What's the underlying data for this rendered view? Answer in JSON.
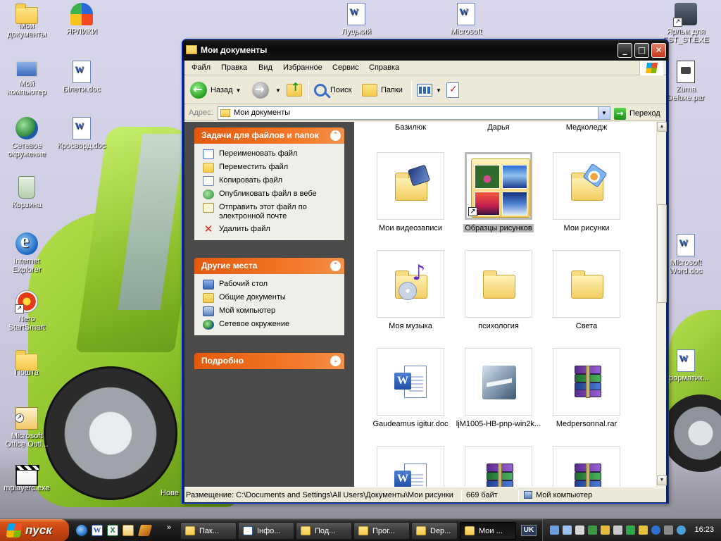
{
  "desktop": {
    "icons_left": [
      {
        "label": "Мои документы",
        "icon": "my-documents-icon"
      },
      {
        "label": "Мой компьютер",
        "icon": "my-computer-icon"
      },
      {
        "label": "Сетевое окружение",
        "icon": "network-places-icon"
      },
      {
        "label": "Корзина",
        "icon": "recycle-bin-icon"
      },
      {
        "label": "Internet Explorer",
        "icon": "internet-explorer-icon"
      },
      {
        "label": "Nero StartSmart",
        "icon": "nero-icon"
      },
      {
        "label": "Пошта",
        "icon": "folder-icon"
      },
      {
        "label": "Microsoft Office Outl...",
        "icon": "outlook-icon"
      },
      {
        "label": "mplayerc.exe",
        "icon": "media-player-icon"
      }
    ],
    "icons_col2": [
      {
        "label": "ЯРЛИКИ",
        "icon": "butterfly-icon"
      },
      {
        "label": "Білети.doc",
        "icon": "word-doc-icon"
      },
      {
        "label": "Кросворд.doc",
        "icon": "word-doc-icon"
      }
    ],
    "icons_top": [
      {
        "label": "Луцький",
        "icon": "word-doc-icon"
      },
      {
        "label": "Microsoft",
        "icon": "word-doc-icon"
      }
    ],
    "icons_right": [
      {
        "label": "Ярлык для EST_ST.EXE",
        "icon": "shortcut-app-icon"
      },
      {
        "label": "Zuma Deluxe.par",
        "icon": "zuma-file-icon"
      },
      {
        "label": "Microsoft Word.doc",
        "icon": "word-doc-icon"
      },
      {
        "label": "нформатик...",
        "icon": "word-doc-icon"
      }
    ],
    "hidden_partial_label": "Нове"
  },
  "window": {
    "title": "Мои документы",
    "menu": [
      "Файл",
      "Правка",
      "Вид",
      "Избранное",
      "Сервис",
      "Справка"
    ],
    "toolbar": {
      "back": "Назад",
      "search": "Поиск",
      "folders": "Папки"
    },
    "address": {
      "label": "Адрес:",
      "value": "Мои документы",
      "go": "Переход"
    },
    "tasks_panel": {
      "title": "Задачи для файлов и папок",
      "items": [
        {
          "label": "Переименовать файл",
          "icon": "rename-icon"
        },
        {
          "label": "Переместить файл",
          "icon": "move-icon"
        },
        {
          "label": "Копировать файл",
          "icon": "copy-icon"
        },
        {
          "label": "Опубликовать файл в вебе",
          "icon": "publish-web-icon"
        },
        {
          "label": "Отправить этот файл по электронной почте",
          "icon": "email-icon"
        },
        {
          "label": "Удалить файл",
          "icon": "delete-icon"
        }
      ]
    },
    "places_panel": {
      "title": "Другие места",
      "items": [
        {
          "label": "Рабочий стол",
          "icon": "desktop-icon"
        },
        {
          "label": "Общие документы",
          "icon": "shared-docs-icon"
        },
        {
          "label": "Мой компьютер",
          "icon": "my-computer-icon"
        },
        {
          "label": "Сетевое окружение",
          "icon": "network-icon"
        }
      ]
    },
    "details_panel": {
      "title": "Подробно"
    },
    "files_partial_top": [
      "Базилюк",
      "Дарья",
      "Медколедж"
    ],
    "files": [
      {
        "label": "Мои видеозаписи",
        "kind": "video-folder"
      },
      {
        "label": "Образцы рисунков",
        "kind": "sample-pictures",
        "selected": true
      },
      {
        "label": "Мои рисунки",
        "kind": "pictures-folder"
      },
      {
        "label": "Моя музыка",
        "kind": "music-folder"
      },
      {
        "label": "психология",
        "kind": "folder"
      },
      {
        "label": "Света",
        "kind": "folder"
      },
      {
        "label": "Gaudeamus igitur.doc",
        "kind": "word"
      },
      {
        "label": "ljM1005-HB-pnp-win2k...",
        "kind": "hp-installer"
      },
      {
        "label": "Medpersonnal.rar",
        "kind": "rar"
      },
      {
        "label": "",
        "kind": "word"
      },
      {
        "label": "",
        "kind": "rar"
      },
      {
        "label": "",
        "kind": "rar"
      }
    ],
    "status": {
      "location": "Размещение: C:\\Documents and Settings\\All Users\\Документы\\Мои рисунки",
      "size": "669 байт",
      "zone": "Мой компьютер"
    }
  },
  "taskbar": {
    "start": "пуск",
    "quicklaunch_more": "»",
    "tasks": [
      {
        "label": "Пак...",
        "icon": "folder"
      },
      {
        "label": "Інфо...",
        "icon": "word"
      },
      {
        "label": "Под...",
        "icon": "folder"
      },
      {
        "label": "Прог...",
        "icon": "folder"
      },
      {
        "label": "Dep...",
        "icon": "folder"
      },
      {
        "label": "Мои ...",
        "icon": "folder",
        "active": true
      }
    ],
    "language": "UK",
    "clock": "16:23"
  }
}
